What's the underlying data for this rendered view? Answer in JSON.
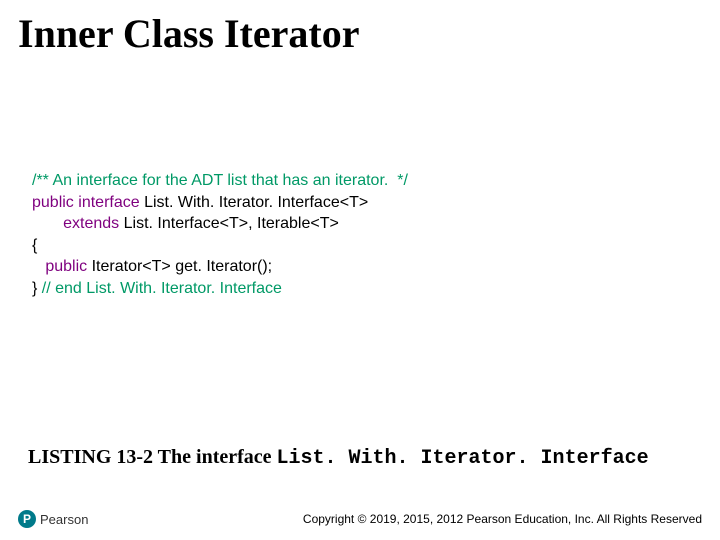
{
  "title": "Inner Class Iterator",
  "code": {
    "comment_line": "/** An interface for the ADT list that has an iterator.  */",
    "kw_public1": "public",
    "kw_interface": "interface",
    "ifacename": " List. With. Iterator. Interface<T>",
    "kw_extends": "extends",
    "extends_rest": " List. Interface<T>, Iterable<T>",
    "brace_open": "{",
    "kw_public2": "public",
    "method_rest": " Iterator<T> get. Iterator();",
    "brace_close": "} ",
    "end_comment": "// end List. With. Iterator. Interface"
  },
  "caption": {
    "prefix": "LISTING 13-2 The interface ",
    "mono": "List. With. Iterator. Interface"
  },
  "logo": {
    "mark_letter": "P",
    "brand": "Pearson"
  },
  "copyright": "Copyright © 2019, 2015, 2012 Pearson Education, Inc. All Rights Reserved"
}
